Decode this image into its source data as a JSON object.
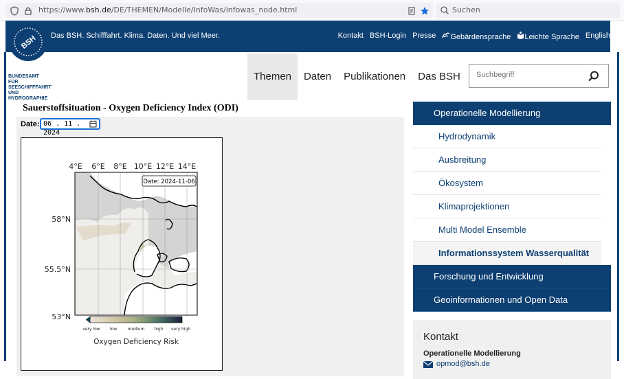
{
  "browser": {
    "url_prefix": "https://www.",
    "url_domain": "bsh.de",
    "url_path": "/DE/THEMEN/Modelle/InfoWas/infowas_node.html",
    "search_placeholder": "Suchen"
  },
  "header": {
    "tagline": "Das BSH. Schifffahrt. Klima. Daten. Und viel Meer.",
    "links": [
      "Kontakt",
      "BSH-Login",
      "Presse",
      "Gebärdensprache",
      "Leichte Sprache",
      "English"
    ],
    "logo_text": "BUNDESAMT FÜR SEESCHIFFFAHRT UND HYDROGRAPHIE",
    "logo_mark": "BSH"
  },
  "nav": {
    "items": [
      "Themen",
      "Daten",
      "Publikationen",
      "Das BSH"
    ],
    "search_placeholder": "Suchbegriff"
  },
  "content": {
    "title": "Sauerstoffsituation - Oxygen Deficiency Index (ODI)",
    "date_label": "Date:",
    "date_value": "06 . 11 . 2024",
    "map": {
      "date_box": "Date: 2024-11-06",
      "lon_ticks": [
        "4°E",
        "6°E",
        "8°E",
        "10°E",
        "12°E",
        "14°E"
      ],
      "lat_ticks": [
        "58°N",
        "55.5°N",
        "53°N"
      ],
      "colorbar_labels": [
        "very low",
        "low",
        "medium",
        "high",
        "very high"
      ],
      "colorbar_title": "Oxygen Deficiency Risk"
    }
  },
  "sidebar": {
    "top": "Operationelle Modellierung",
    "subitems": [
      "Hydrodynamik",
      "Ausbreitung",
      "Ökosystem",
      "Klimaprojektionen",
      "Multi Model Ensemble",
      "Informationssystem Wasserqualität"
    ],
    "more": [
      "Forschung und Entwicklung",
      "Geoinformationen und Open Data"
    ]
  },
  "contact": {
    "heading": "Kontakt",
    "subheading": "Operationelle Modellierung",
    "email": "opmod@bsh.de"
  },
  "colors": {
    "brand": "#0d3f72",
    "accent": "#1a6fd6"
  }
}
